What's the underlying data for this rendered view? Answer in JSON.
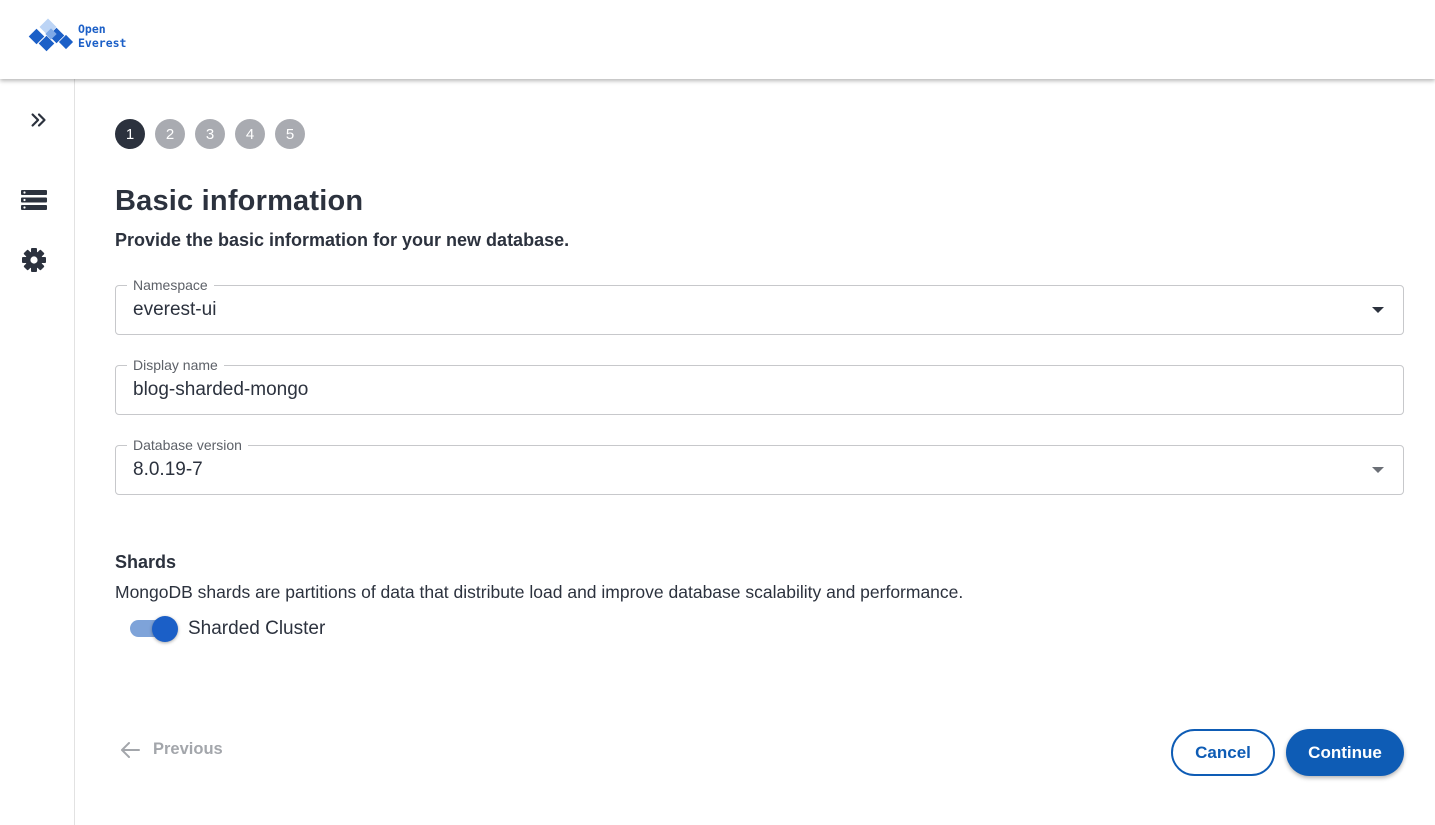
{
  "brand": {
    "line1": "Open",
    "line2": "Everest",
    "color": "#1b5fc7"
  },
  "sidenav": {
    "items": [
      {
        "icon": "double-chevron-right-icon"
      },
      {
        "icon": "database-list-icon"
      },
      {
        "icon": "gear-icon"
      }
    ]
  },
  "stepper": {
    "current": 1,
    "steps": [
      {
        "label": "1"
      },
      {
        "label": "2"
      },
      {
        "label": "3"
      },
      {
        "label": "4"
      },
      {
        "label": "5"
      }
    ]
  },
  "page": {
    "title": "Basic information",
    "subtitle": "Provide the basic information for your new database."
  },
  "form": {
    "namespace": {
      "label": "Namespace",
      "value": "everest-ui"
    },
    "display_name": {
      "label": "Display name",
      "value": "blog-sharded-mongo"
    },
    "db_version": {
      "label": "Database version",
      "value": "8.0.19-7"
    }
  },
  "shards": {
    "title": "Shards",
    "description": "MongoDB shards are partitions of data that distribute load and improve database scalability and performance.",
    "toggle_label": "Sharded Cluster",
    "enabled": true
  },
  "actions": {
    "previous": "Previous",
    "cancel": "Cancel",
    "continue": "Continue"
  },
  "colors": {
    "primary": "#0e5cb5",
    "step_active": "#2c323e",
    "step_inactive": "#a9abb1"
  }
}
